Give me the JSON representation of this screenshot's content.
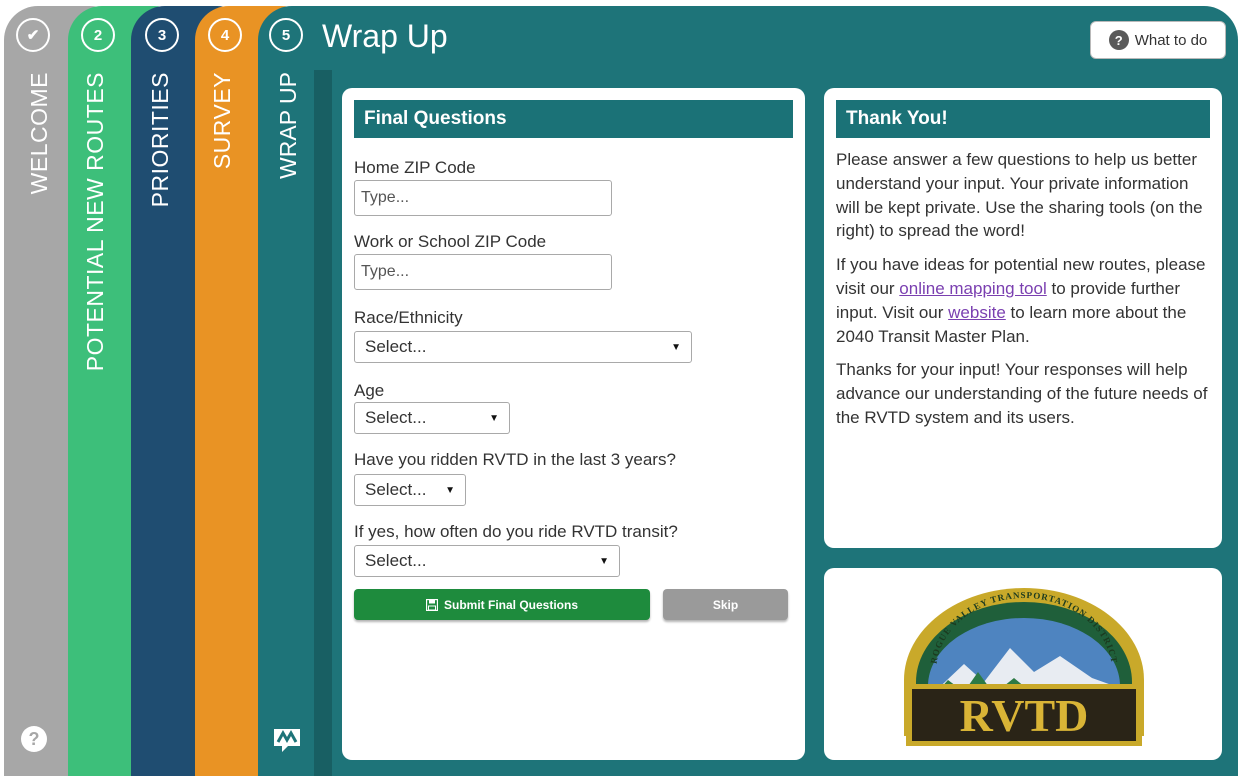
{
  "tabs": [
    {
      "number": "✔",
      "label": "WELCOME",
      "color": "#a7a7a7"
    },
    {
      "number": "2",
      "label": "POTENTIAL NEW ROUTES",
      "color": "#3dbf7a"
    },
    {
      "number": "3",
      "label": "PRIORITIES",
      "color": "#1f4d71"
    },
    {
      "number": "4",
      "label": "SURVEY",
      "color": "#e99324"
    },
    {
      "number": "5",
      "label": "WRAP UP",
      "color": "#1e7479"
    }
  ],
  "header": {
    "title": "Wrap Up",
    "help_button": "What to do"
  },
  "form": {
    "heading": "Final Questions",
    "home_zip_label": "Home ZIP Code",
    "home_zip_placeholder": "Type...",
    "work_zip_label": "Work or School ZIP Code",
    "work_zip_placeholder": "Type...",
    "race_label": "Race/Ethnicity",
    "race_value": "Select...",
    "age_label": "Age",
    "age_value": "Select...",
    "ridden_label": "Have you ridden RVTD in the last 3 years?",
    "ridden_value": "Select...",
    "often_label": "If yes, how often do you ride RVTD transit?",
    "often_value": "Select...",
    "submit_label": "Submit Final Questions",
    "skip_label": "Skip"
  },
  "thanks": {
    "heading": "Thank You!",
    "para1": "Please answer a few questions to help us better understand your input. Your private information will be kept private. Use the sharing tools (on the right) to spread the word!",
    "para2_a": "If you have ideas for potential new routes, please visit our ",
    "link_mapping": "online mapping tool",
    "para2_b": " to provide further input. Visit our ",
    "link_website": "website",
    "para2_c": " to learn more about the 2040 Transit Master Plan.",
    "para3": "Thanks for your input! Your responses will help advance our understanding of the future needs of the RVTD system and its users."
  },
  "logo": {
    "arc_text": "ROGUE VALLEY TRANSPORTATION DISTRICT",
    "name": "RVTD"
  },
  "icons": {
    "help": "?",
    "check": "check-icon",
    "save": "save-icon"
  }
}
